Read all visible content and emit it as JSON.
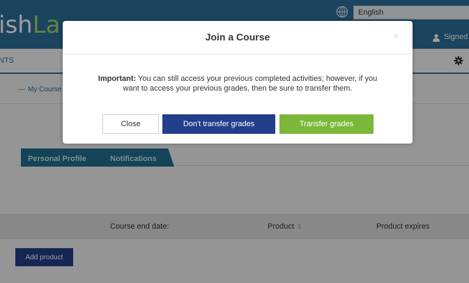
{
  "header": {
    "logo_main": "ish",
    "logo_accent": "La",
    "language": "English",
    "signed": "Signed"
  },
  "nav": {
    "item": "NTS"
  },
  "breadcrumb": {
    "dash": "—",
    "link": "My Course"
  },
  "tabs": [
    {
      "label": "Personal Profile"
    },
    {
      "label": "Notifications"
    }
  ],
  "table": {
    "headers": {
      "course_end": "Course end date:",
      "product": "Product",
      "product_expires": "Product expires"
    },
    "add_button": "Add product"
  },
  "modal": {
    "title": "Join a Course",
    "close_symbol": "×",
    "important_label": "Important:",
    "message_line1": " You can still access your previous completed activities; however, if you",
    "message_line2": "want to access your previous grades, then be sure to transfer them.",
    "buttons": {
      "close": "Close",
      "dont_transfer": "Don't transfer grades",
      "transfer": "Transfer grades"
    }
  },
  "colors": {
    "header": "#2c6f9a",
    "primary_button": "#233e8a",
    "success_button": "#7bb83a",
    "tab_bar": "#1f6f8f"
  }
}
